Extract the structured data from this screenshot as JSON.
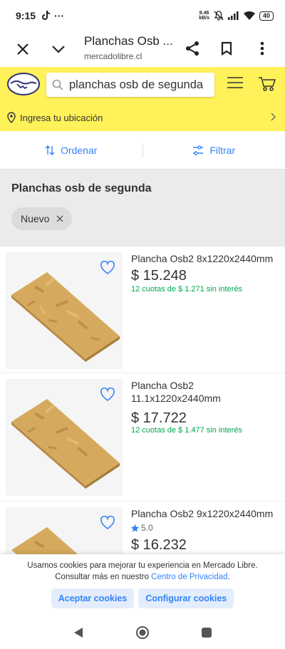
{
  "status": {
    "time": "9:15",
    "speed_top": "8.46",
    "speed_bottom": "kB/s",
    "battery": "40"
  },
  "browser": {
    "title": "Planchas Osb ...",
    "url": "mercadolibre.cl"
  },
  "header": {
    "search_query": "planchas osb de segunda",
    "location": "Ingresa tu ubicación"
  },
  "toolbar": {
    "sort": "Ordenar",
    "filter": "Filtrar"
  },
  "results": {
    "title": "Planchas osb de segunda",
    "chip": "Nuevo"
  },
  "products": [
    {
      "title": "Plancha Osb2 8x1220x2440mm",
      "price": "$ 15.248",
      "installments": "12 cuotas de $ 1.271 sin interés"
    },
    {
      "title": "Plancha Osb2 11.1x1220x2440mm",
      "price": "$ 17.722",
      "installments": "12 cuotas de $ 1.477 sin interés"
    },
    {
      "title": "Plancha Osb2 9x1220x2440mm",
      "rating": "5.0",
      "price": "$ 16.232"
    }
  ],
  "cookie": {
    "line1": "Usamos cookies para mejorar tu experiencia en Mercado Libre.",
    "line2": "Consultar más en nuestro",
    "link": "Centro de Privacidad",
    "accept": "Aceptar cookies",
    "configure": "Configurar cookies"
  },
  "colors": {
    "brand_yellow": "#fff159",
    "accent_blue": "#3483fa",
    "green": "#00a650"
  },
  "icons": [
    "close-icon",
    "chevron-down-icon",
    "share-icon",
    "bookmark-icon",
    "more-icon",
    "search-icon",
    "menu-icon",
    "cart-icon",
    "location-pin-icon",
    "sort-icon",
    "filter-icon",
    "heart-icon",
    "star-icon"
  ]
}
